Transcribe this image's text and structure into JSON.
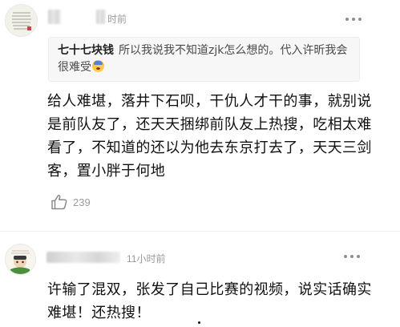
{
  "comments": [
    {
      "time": "时前",
      "reply": {
        "author": "七十七块钱",
        "text": "所以我说我不知道zjk怎么想的。代入许昕我会很难受",
        "emoji": "anxious-face-emoji"
      },
      "text": "给人难堪，落井下石呗，干仇人才干的事，就别说是前队友了，还天天捆绑前队友上热搜，吃相太难看了，不知道的还以为他去东京打去了，天天三剑客，置小胖于何地",
      "likes": "239"
    },
    {
      "time": "11小时前",
      "text": "许输了混双，张发了自己比赛的视频，说实话确实难堪！还热搜！"
    }
  ],
  "icons": {
    "more": "more-dots-icon",
    "like": "thumbs-up-icon"
  },
  "colors": {
    "meta_text": "#9a9a9a",
    "quote_bg": "#f7f7f7",
    "body_text": "#111111"
  }
}
